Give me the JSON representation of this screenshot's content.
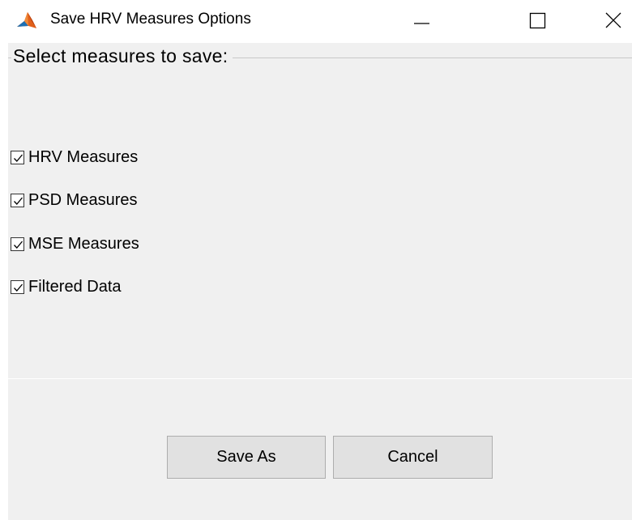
{
  "window": {
    "title": "Save HRV Measures Options",
    "icon": "matlab-icon"
  },
  "group": {
    "legend": "Select measures to save:"
  },
  "checkboxes": [
    {
      "label": "HRV Measures",
      "checked": true
    },
    {
      "label": "PSD Measures",
      "checked": true
    },
    {
      "label": "MSE Measures",
      "checked": true
    },
    {
      "label": "Filtered Data",
      "checked": true
    }
  ],
  "buttons": {
    "save_as": "Save As",
    "cancel": "Cancel"
  }
}
